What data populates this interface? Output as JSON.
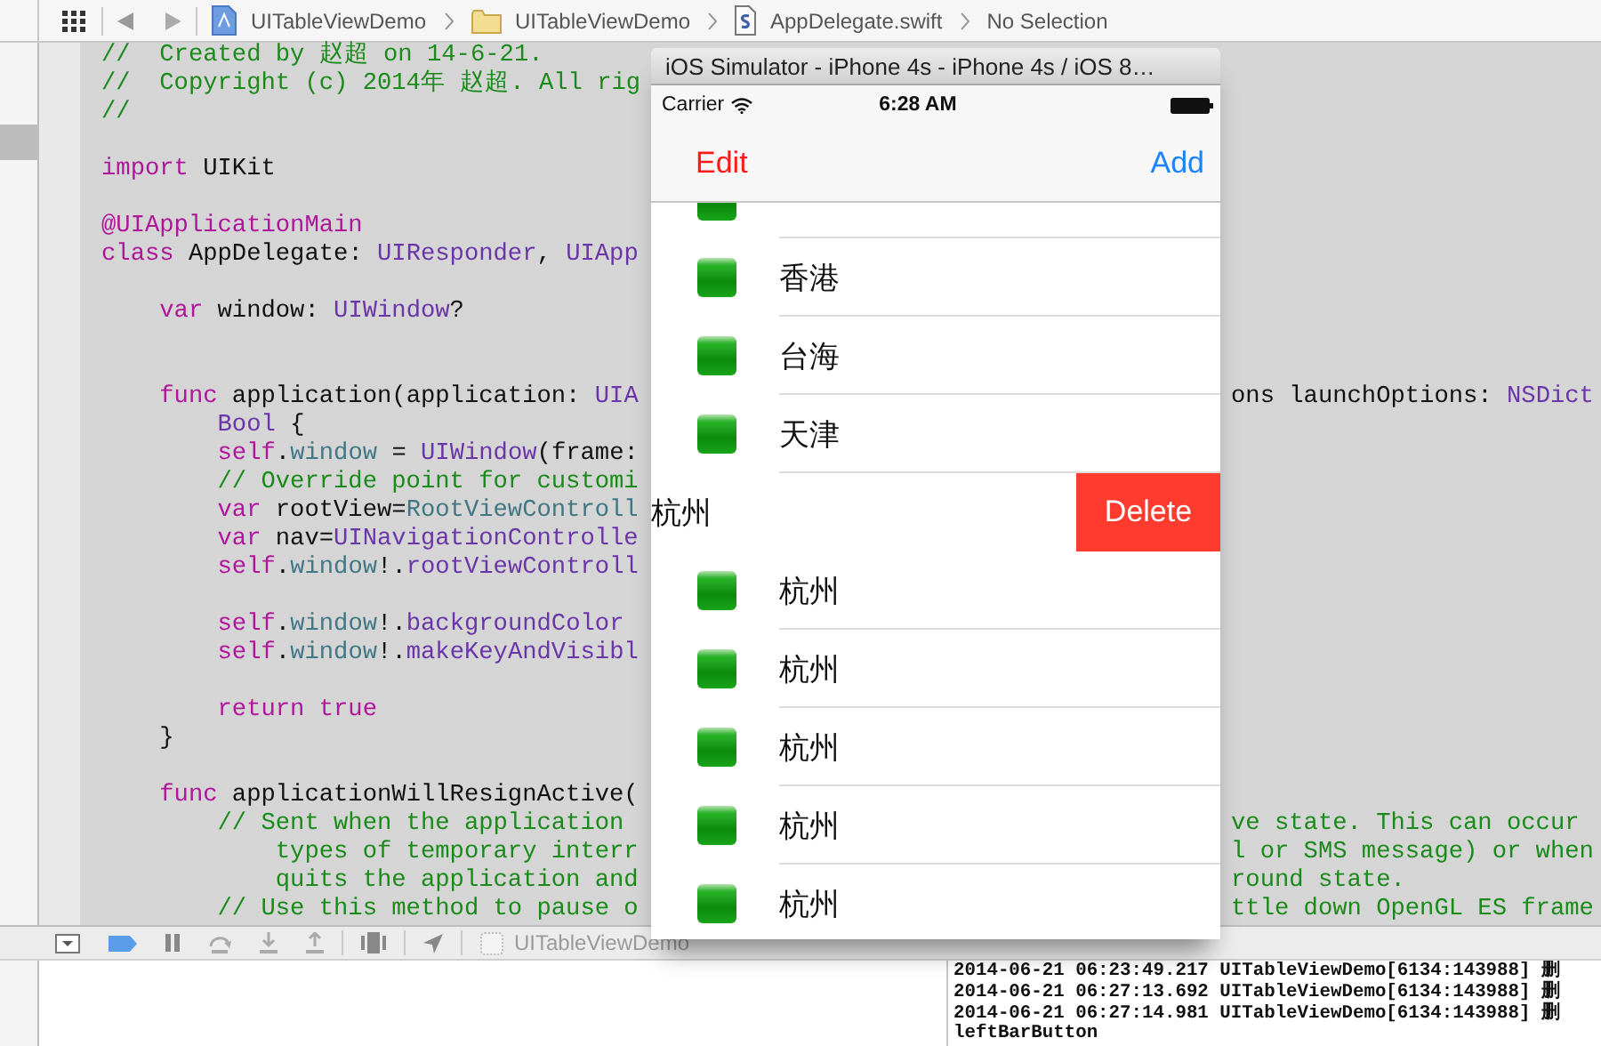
{
  "jump_bar": {
    "path": [
      {
        "label": "UITableViewDemo",
        "kind": "project"
      },
      {
        "label": "UITableViewDemo",
        "kind": "folder"
      },
      {
        "label": "AppDelegate.swift",
        "kind": "swift"
      },
      {
        "label": "No Selection",
        "kind": "none"
      }
    ]
  },
  "code_lines": [
    {
      "kind": "code",
      "left": [
        {
          "comment": "//  Created by 赵超 on 14-6-21."
        }
      ]
    },
    {
      "kind": "code",
      "left": [
        {
          "comment": "//  Copyright (c) 2014年 赵超. All rig"
        }
      ]
    },
    {
      "kind": "code",
      "left": [
        {
          "comment": "//"
        }
      ]
    },
    {
      "kind": "blank"
    },
    {
      "kind": "code",
      "left": [
        {
          "keyword": "import"
        },
        {
          "plain": " UIKit"
        }
      ]
    },
    {
      "kind": "blank"
    },
    {
      "kind": "code",
      "left": [
        {
          "keyword": "@UIApplicationMain"
        }
      ]
    },
    {
      "kind": "code",
      "left": [
        {
          "keyword": "class"
        },
        {
          "plain": " AppDelegate: "
        },
        {
          "type": "UIResponder"
        },
        {
          "plain": ", "
        },
        {
          "type": "UIApp"
        }
      ]
    },
    {
      "kind": "blank"
    },
    {
      "kind": "code",
      "left": [
        {
          "keyword": "    var"
        },
        {
          "plain": " window: "
        },
        {
          "type": "UIWindow"
        },
        {
          "plain": "?"
        }
      ]
    },
    {
      "kind": "blank"
    },
    {
      "kind": "blank"
    },
    {
      "kind": "code",
      "left": [
        {
          "keyword": "    func"
        },
        {
          "plain": " application(application: "
        },
        {
          "type": "UIA"
        }
      ],
      "right": [
        {
          "plain": "ons launchOptions: "
        },
        {
          "type": "NSDict"
        }
      ]
    },
    {
      "kind": "code",
      "left": [
        {
          "type": "        Bool"
        },
        {
          "plain": " {"
        }
      ]
    },
    {
      "kind": "code",
      "left": [
        {
          "keyword": "        self"
        },
        {
          "plain": "."
        },
        {
          "ident": "window"
        },
        {
          "plain": " = "
        },
        {
          "type": "UIWindow"
        },
        {
          "plain": "(frame:"
        }
      ]
    },
    {
      "kind": "code",
      "left": [
        {
          "comment": "        // Override point for customi"
        }
      ]
    },
    {
      "kind": "code",
      "left": [
        {
          "keyword": "        var"
        },
        {
          "plain": " rootView="
        },
        {
          "ident": "RootViewControll"
        }
      ]
    },
    {
      "kind": "code",
      "left": [
        {
          "keyword": "        var"
        },
        {
          "plain": " nav="
        },
        {
          "type": "UINavigationControlle"
        }
      ]
    },
    {
      "kind": "code",
      "left": [
        {
          "keyword": "        self"
        },
        {
          "plain": "."
        },
        {
          "ident": "window"
        },
        {
          "plain": "!."
        },
        {
          "method": "rootViewControll"
        }
      ]
    },
    {
      "kind": "blank"
    },
    {
      "kind": "code",
      "left": [
        {
          "keyword": "        self"
        },
        {
          "plain": "."
        },
        {
          "ident": "window"
        },
        {
          "plain": "!."
        },
        {
          "method": "backgroundColor"
        }
      ]
    },
    {
      "kind": "code",
      "left": [
        {
          "keyword": "        self"
        },
        {
          "plain": "."
        },
        {
          "ident": "window"
        },
        {
          "plain": "!."
        },
        {
          "method": "makeKeyAndVisibl"
        }
      ]
    },
    {
      "kind": "blank"
    },
    {
      "kind": "code",
      "left": [
        {
          "keyword": "        return true"
        }
      ]
    },
    {
      "kind": "code",
      "left": [
        {
          "plain": "    }"
        }
      ]
    },
    {
      "kind": "blank"
    },
    {
      "kind": "code",
      "left": [
        {
          "keyword": "    func"
        },
        {
          "plain": " applicationWillResignActive("
        }
      ]
    },
    {
      "kind": "code",
      "left": [
        {
          "comment": "        // Sent when the application"
        }
      ],
      "right": [
        {
          "comment": "ve state. This can occur"
        }
      ]
    },
    {
      "kind": "code",
      "left": [
        {
          "comment": "            types of temporary interr"
        }
      ],
      "right": [
        {
          "comment": "l or SMS message) or when"
        }
      ]
    },
    {
      "kind": "code",
      "left": [
        {
          "comment": "            quits the application and"
        }
      ],
      "right": [
        {
          "comment": "round state."
        }
      ]
    },
    {
      "kind": "code",
      "left": [
        {
          "comment": "        // Use this method to pause o"
        }
      ],
      "right": [
        {
          "comment": "ttle down OpenGL ES frame"
        }
      ]
    }
  ],
  "debug_bar": {
    "scheme": "UITableViewDemo"
  },
  "console_lines": [
    "2014-06-21 06:23:49.217 UITableViewDemo[6134:143988] 删",
    "2014-06-21 06:27:13.692 UITableViewDemo[6134:143988] 删",
    "2014-06-21 06:27:14.981 UITableViewDemo[6134:143988] 删",
    "leftBarButton"
  ],
  "simulator": {
    "title": "iOS Simulator - iPhone 4s - iPhone 4s / iOS 8…",
    "carrier": "Carrier",
    "time": "6:28 AM",
    "nav_left": "Edit",
    "nav_right": "Add",
    "rows": [
      {
        "title": "香港",
        "swiped": false
      },
      {
        "title": "台海",
        "swiped": false
      },
      {
        "title": "天津",
        "swiped": false
      },
      {
        "title": "杭州",
        "swiped": true,
        "action": "Delete"
      },
      {
        "title": "杭州",
        "swiped": false
      },
      {
        "title": "杭州",
        "swiped": false
      },
      {
        "title": "杭州",
        "swiped": false
      },
      {
        "title": "杭州",
        "swiped": false
      },
      {
        "title": "杭州",
        "swiped": false
      }
    ]
  }
}
